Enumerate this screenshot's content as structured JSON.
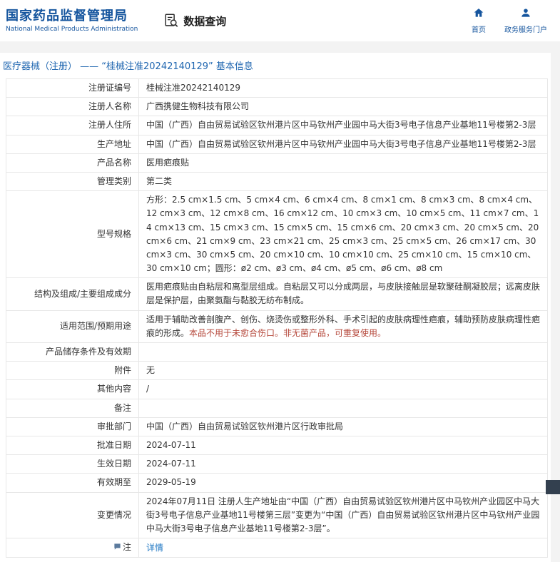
{
  "header": {
    "org_name_cn": "国家药品监督管理局",
    "org_name_en": "National Medical Products Administration",
    "query_label": "数据查询",
    "nav": [
      {
        "label": "首页"
      },
      {
        "label": "政务服务门户"
      }
    ]
  },
  "breadcrumb": "医疗器械（注册） —— “桂械注准20242140129” 基本信息",
  "colors": {
    "brand_blue": "#15559e",
    "breadcrumb_blue": "#1f66b0",
    "link_blue": "#2279c4",
    "warning_red": "#b5473a"
  },
  "table": {
    "rows": [
      {
        "label": "注册证编号",
        "value": "桂械注准20242140129"
      },
      {
        "label": "注册人名称",
        "value": "广西携健生物科技有限公司"
      },
      {
        "label": "注册人住所",
        "value": "中国（广西）自由贸易试验区钦州港片区中马钦州产业园中马大街3号电子信息产业基地11号楼第2-3层"
      },
      {
        "label": "生产地址",
        "value": "中国（广西）自由贸易试验区钦州港片区中马钦州产业园中马大街3号电子信息产业基地11号楼第2-3层"
      },
      {
        "label": "产品名称",
        "value": "医用疤痕贴"
      },
      {
        "label": "管理类别",
        "value": "第二类"
      },
      {
        "label": "型号规格",
        "value": "方形：2.5 cm×1.5 cm、5 cm×4 cm、6 cm×4 cm、8 cm×1 cm、8 cm×3 cm、8 cm×4 cm、12 cm×3 cm、12 cm×8 cm、16 cm×12 cm、10 cm×3 cm、10 cm×5 cm、11 cm×7 cm、14 cm×13 cm、15 cm×3 cm、15 cm×5 cm、15 cm×6 cm、20 cm×3 cm、20 cm×5 cm、20 cm×6 cm、21 cm×9 cm、23 cm×21 cm、25 cm×3 cm、25 cm×5 cm、26 cm×17 cm、30 cm×3 cm、30 cm×5 cm、20 cm×10 cm、10 cm×10 cm、25 cm×10 cm、15 cm×10 cm、30 cm×10 cm；圆形：ø2 cm、ø3 cm、ø4 cm、ø5 cm、ø6 cm、ø8 cm"
      },
      {
        "label": "结构及组成/主要组成成分",
        "value": "医用疤痕贴由自粘层和离型层组成。自粘层又可以分成两层，与皮肤接触层是软聚硅酮凝胶层；远离皮肤层是保护层，由聚氨酯与黏胶无纺布制成。"
      },
      {
        "label": "适用范围/预期用途",
        "value": "适用于辅助改善剖腹产、创伤、烧烫伤或整形外科、手术引起的皮肤病理性疤痕，辅助预防皮肤病理性疤痕的形成。",
        "value_red": "本品不用于未愈合伤口。非无菌产品，可重复使用。"
      },
      {
        "label": "产品储存条件及有效期",
        "value": ""
      },
      {
        "label": "附件",
        "value": "无"
      },
      {
        "label": "其他内容",
        "value": "/"
      },
      {
        "label": "备注",
        "value": ""
      },
      {
        "label": "审批部门",
        "value": "中国（广西）自由贸易试验区钦州港片区行政审批局"
      },
      {
        "label": "批准日期",
        "value": "2024-07-11"
      },
      {
        "label": "生效日期",
        "value": "2024-07-11"
      },
      {
        "label": "有效期至",
        "value": "2029-05-19"
      },
      {
        "label": "变更情况",
        "value": "2024年07月11日 注册人生产地址由“中国（广西）自由贸易试验区钦州港片区中马钦州产业园区中马大街3号电子信息产业基地11号楼第三层”变更为“中国（广西）自由贸易试验区钦州港片区中马钦州产业园中马大街3号电子信息产业基地11号楼第2-3层”。"
      },
      {
        "label": "注",
        "link": "详情"
      }
    ]
  }
}
